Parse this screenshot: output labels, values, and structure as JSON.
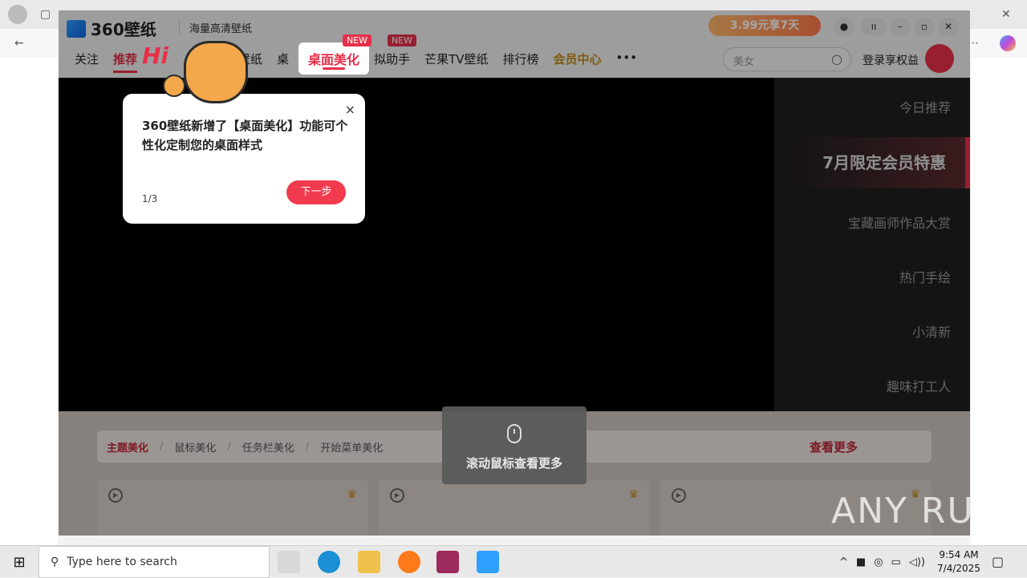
{
  "app": {
    "logo": "360壁纸",
    "tagline": "海量高清壁纸",
    "nav": [
      "关注",
      "推荐",
      "",
      "",
      "壁纸",
      "桌",
      "桌面美化",
      "拟助手",
      "芒果TV壁纸",
      "排行榜",
      "会员中心",
      "•••"
    ],
    "badge_new": "NEW",
    "badge_new2": "NEW",
    "promo": "3.99元享7天",
    "search_placeholder": "美女",
    "login": "登录享权益",
    "mascot_hi": "Hi"
  },
  "side_menu": [
    "今日推荐",
    "7月限定会员特惠",
    "宝藏画师作品大赏",
    "热门手绘",
    "小清新",
    "趣味打工人"
  ],
  "tooltip": {
    "text": "360壁纸新增了【桌面美化】功能可个性化定制您的桌面样式",
    "step": "1/3",
    "next": "下一步",
    "close": "×"
  },
  "filters": [
    "主题美化",
    "鼠标美化",
    "任务栏美化",
    "开始菜单美化"
  ],
  "see_more": "查看更多",
  "scroll_hint": "滚动鼠标查看更多",
  "watermark": "ANY RUN",
  "taskbar": {
    "search": "Type here to search",
    "time": "9:54 AM",
    "date": "7/4/2025"
  }
}
